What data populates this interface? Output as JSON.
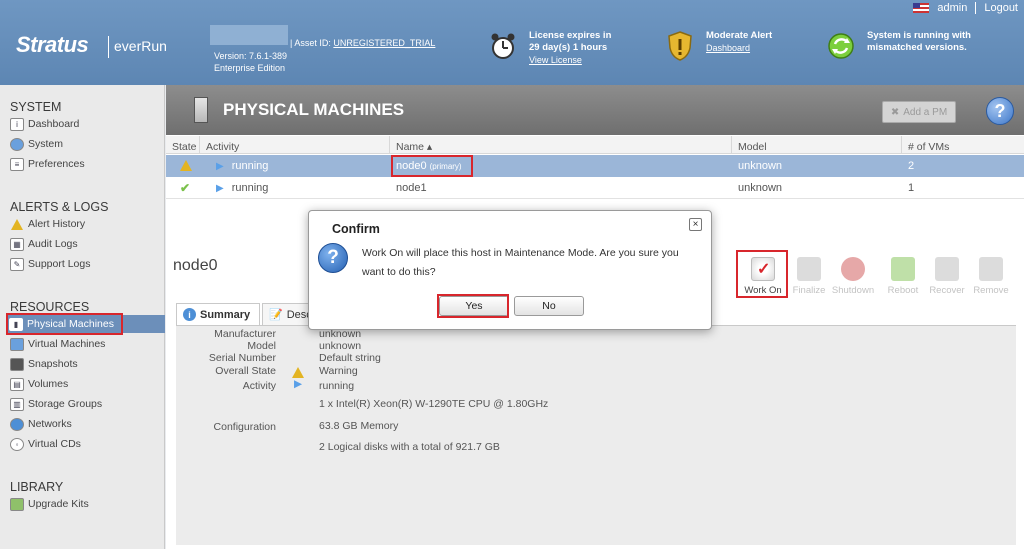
{
  "header": {
    "brand": "Stratus",
    "product": "everRun",
    "version": "Version: 7.6.1-389",
    "edition": "Enterprise Edition",
    "asset_label": "| Asset ID:",
    "asset_value": "UNREGISTERED_TRIAL",
    "license_line1": "License expires in",
    "license_line2": "29 day(s) 1 hours",
    "license_link": "View License",
    "alert_title": "Moderate Alert",
    "alert_link": "Dashboard",
    "status_line1": "System is running with",
    "status_line2": "mismatched versions.",
    "user": "admin",
    "logout": "Logout"
  },
  "sidebar": {
    "system_title": "SYSTEM",
    "system_items": [
      "Dashboard",
      "System",
      "Preferences"
    ],
    "alerts_title": "ALERTS & LOGS",
    "alerts_items": [
      "Alert History",
      "Audit Logs",
      "Support Logs"
    ],
    "resources_title": "RESOURCES",
    "resources_items": [
      "Physical Machines",
      "Virtual Machines",
      "Snapshots",
      "Volumes",
      "Storage Groups",
      "Networks",
      "Virtual CDs"
    ],
    "library_title": "LIBRARY",
    "library_items": [
      "Upgrade Kits"
    ]
  },
  "page": {
    "title": "PHYSICAL MACHINES",
    "add_pm": "Add a PM",
    "help": "?"
  },
  "table": {
    "columns": [
      "State",
      "Activity",
      "Name ▴",
      "Model",
      "# of VMs"
    ],
    "rows": [
      {
        "state": "warning",
        "activity": "running",
        "name": "node0",
        "tag": "(primary)",
        "model": "unknown",
        "vms": "2"
      },
      {
        "state": "ok",
        "activity": "running",
        "name": "node1",
        "tag": "",
        "model": "unknown",
        "vms": "1"
      }
    ]
  },
  "detail": {
    "name": "node0",
    "actions": [
      "Work On",
      "Finalize",
      "Shutdown",
      "Reboot",
      "Recover",
      "Remove"
    ],
    "tabs": [
      "Summary",
      "Desc"
    ],
    "labels": [
      "Manufacturer",
      "Model",
      "Serial Number",
      "Overall State",
      "Activity",
      "Configuration"
    ],
    "values": [
      "unknown",
      "unknown",
      "Default string",
      "Warning",
      "running",
      "1 x Intel(R) Xeon(R) W-1290TE CPU @ 1.80GHz",
      "63.8 GB Memory",
      "2 Logical disks with a total of 921.7 GB"
    ]
  },
  "dialog": {
    "title": "Confirm",
    "close": "×",
    "message": "Work On will place this host in Maintenance Mode. Are you sure you want to do this?",
    "yes": "Yes",
    "no": "No"
  },
  "colors": {
    "header_blue": "#6f97c2",
    "selected_row": "#9bb6d8",
    "active_nav": "#6c8fba",
    "highlight_red": "#d8262c"
  }
}
